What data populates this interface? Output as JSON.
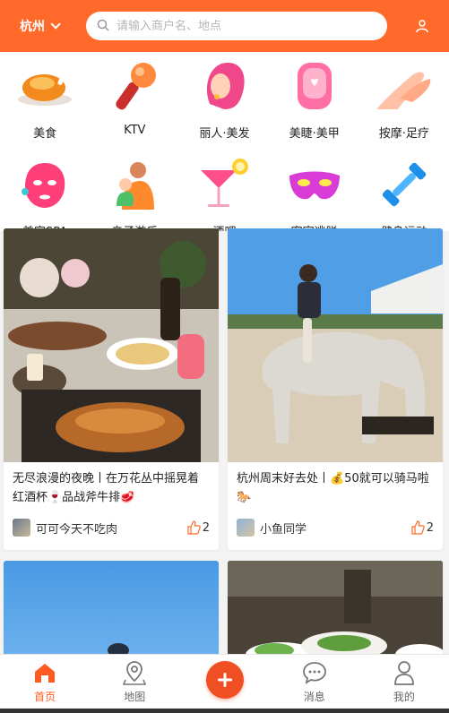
{
  "header": {
    "city": "杭州",
    "search_placeholder": "请输入商户名、地点",
    "accent": "#ff6a2b"
  },
  "categories": [
    {
      "label": "美食",
      "icon": "roast-chicken-icon"
    },
    {
      "label": "KTV",
      "icon": "microphone-icon"
    },
    {
      "label": "丽人·美发",
      "icon": "hair-salon-icon"
    },
    {
      "label": "美睫·美甲",
      "icon": "nail-icon"
    },
    {
      "label": "按摩·足疗",
      "icon": "massage-hand-icon"
    },
    {
      "label": "美容SPA",
      "icon": "face-mask-icon"
    },
    {
      "label": "亲子游乐",
      "icon": "parent-child-icon"
    },
    {
      "label": "酒吧",
      "icon": "cocktail-icon"
    },
    {
      "label": "密室逃脱",
      "icon": "mask-icon"
    },
    {
      "label": "健身运动",
      "icon": "dumbbell-icon"
    }
  ],
  "feed": [
    {
      "title": "无尽浪漫的夜晚丨在万花丛中摇晃着红酒杯🍷品战斧牛排🥩",
      "author": "可可今天不吃肉",
      "likes": "2",
      "image": "dinner-table-photo"
    },
    {
      "title": "杭州周末好去处丨💰50就可以骑马啦🐎",
      "author": "小鱼同学",
      "likes": "2",
      "image": "horse-riding-photo"
    },
    {
      "image": "sky-photo"
    },
    {
      "image": "restaurant-photo"
    }
  ],
  "tabs": [
    {
      "label": "首页",
      "icon": "home-icon",
      "active": true
    },
    {
      "label": "地图",
      "icon": "map-pin-icon"
    },
    {
      "label": "",
      "icon": "plus-icon"
    },
    {
      "label": "消息",
      "icon": "chat-icon"
    },
    {
      "label": "我的",
      "icon": "profile-icon"
    }
  ]
}
